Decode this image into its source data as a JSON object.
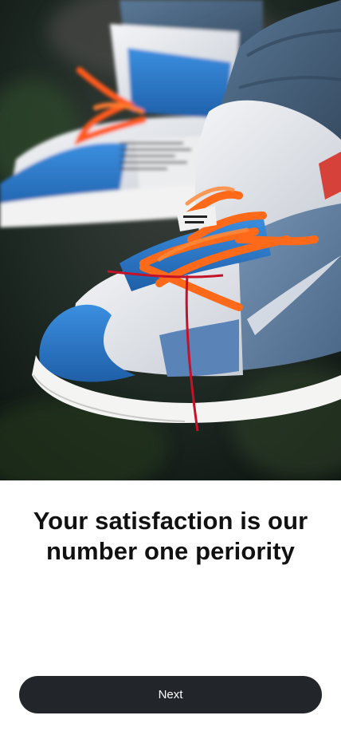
{
  "onboarding": {
    "hero_image": {
      "subject": "sneakers-photo",
      "colors": {
        "background_dark": "#1c2420",
        "shoe_blue": "#2f7fcf",
        "shoe_white": "#e8ebee",
        "laces_orange": "#ff6a1a",
        "denim": "#4a6584"
      }
    },
    "headline": "Your satisfaction is our number one periority",
    "next_button_label": "Next",
    "button_color": "#22252a"
  }
}
